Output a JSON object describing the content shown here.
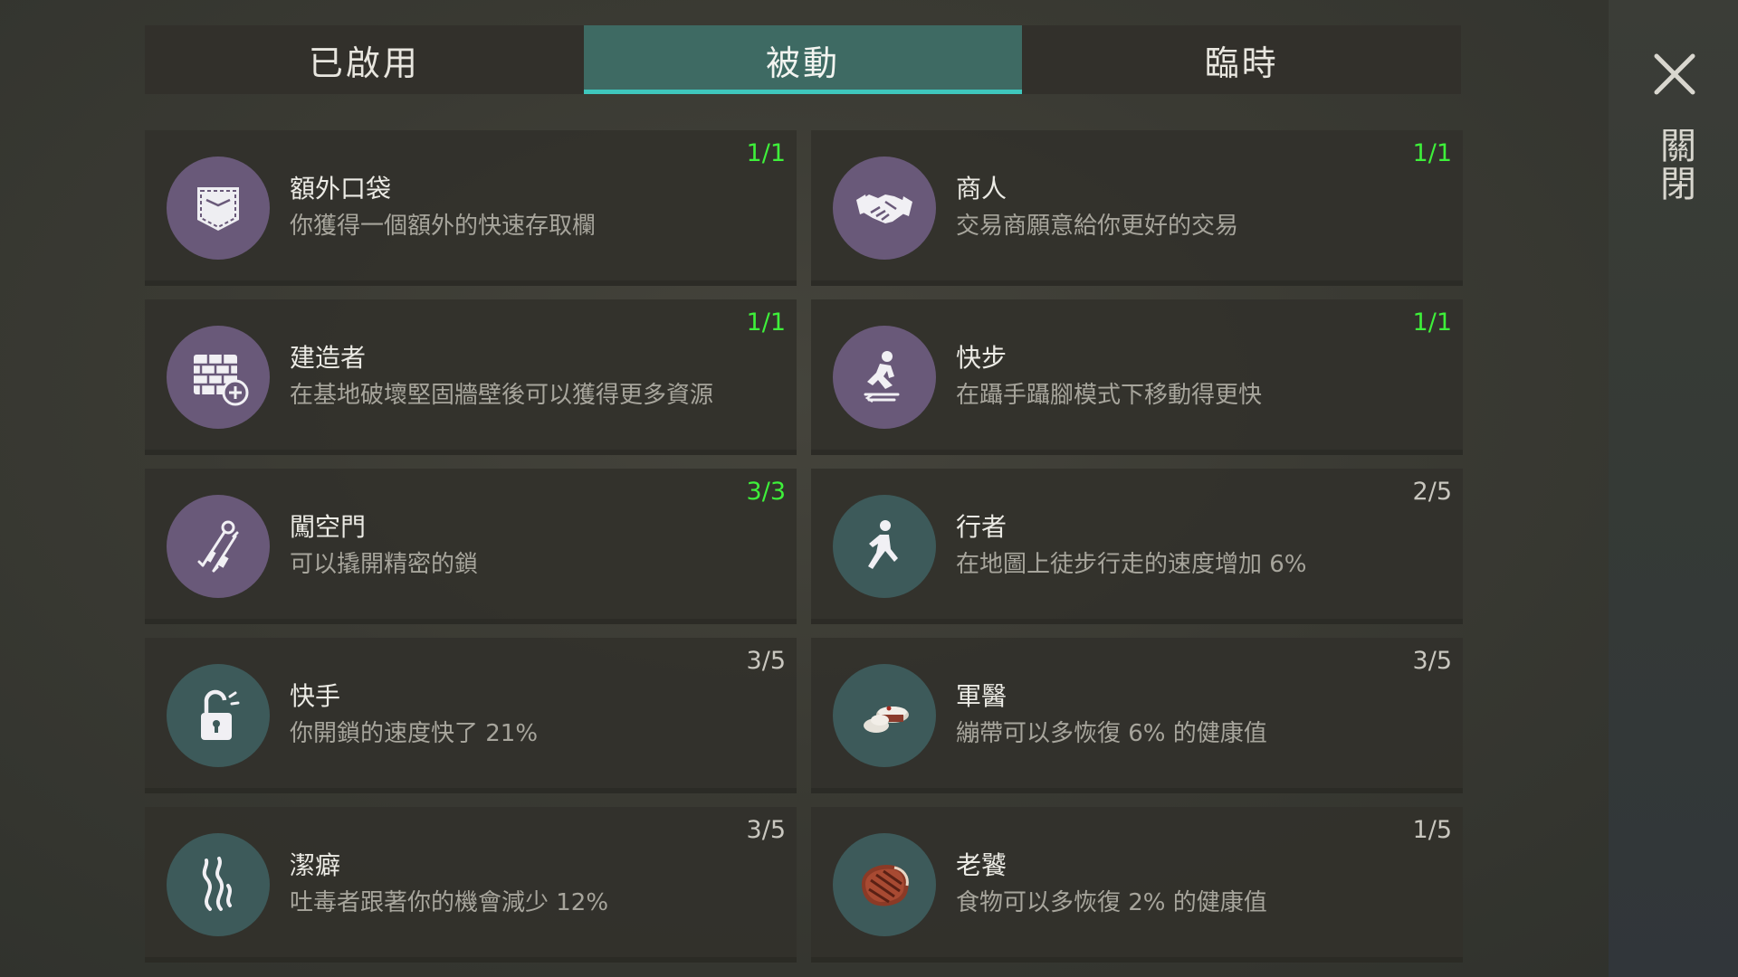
{
  "tabs": [
    {
      "label": "已啟用",
      "active": false
    },
    {
      "label": "被動",
      "active": true
    },
    {
      "label": "臨時",
      "active": false
    }
  ],
  "close": {
    "label": "關閉",
    "icon": "close-icon"
  },
  "colors": {
    "accent": "#3fc7bd",
    "max_level": "#3ef03a",
    "purple_icon": "#695979",
    "teal_icon": "#3d5a5a"
  },
  "perks": [
    {
      "name": "額外口袋",
      "desc": "你獲得一個額外的快速存取欄",
      "level": "1/1",
      "max": true,
      "icon": "pocket-icon",
      "icon_bg": "purple"
    },
    {
      "name": "商人",
      "desc": "交易商願意給你更好的交易",
      "level": "1/1",
      "max": true,
      "icon": "handshake-icon",
      "icon_bg": "purple"
    },
    {
      "name": "建造者",
      "desc": "在基地破壞堅固牆壁後可以獲得更多資源",
      "level": "1/1",
      "max": true,
      "icon": "brick-wall-icon",
      "icon_bg": "purple"
    },
    {
      "name": "快步",
      "desc": "在躡手躡腳模式下移動得更快",
      "level": "1/1",
      "max": true,
      "icon": "sneak-icon",
      "icon_bg": "purple"
    },
    {
      "name": "闖空門",
      "desc": "可以撬開精密的鎖",
      "level": "3/3",
      "max": true,
      "icon": "lockpick-icon",
      "icon_bg": "purple"
    },
    {
      "name": "行者",
      "desc": "在地圖上徒步行走的速度增加 6%",
      "level": "2/5",
      "max": false,
      "icon": "walker-icon",
      "icon_bg": "teal"
    },
    {
      "name": "快手",
      "desc": "你開鎖的速度快了 21%",
      "level": "3/5",
      "max": false,
      "icon": "unlock-icon",
      "icon_bg": "teal"
    },
    {
      "name": "軍醫",
      "desc": "繃帶可以多恢復 6% 的健康值",
      "level": "3/5",
      "max": false,
      "icon": "bandage-icon",
      "icon_bg": "teal"
    },
    {
      "name": "潔癖",
      "desc": "吐毒者跟著你的機會減少 12%",
      "level": "3/5",
      "max": false,
      "icon": "smoke-icon",
      "icon_bg": "teal"
    },
    {
      "name": "老饕",
      "desc": "食物可以多恢復 2% 的健康值",
      "level": "1/5",
      "max": false,
      "icon": "steak-icon",
      "icon_bg": "teal"
    }
  ]
}
